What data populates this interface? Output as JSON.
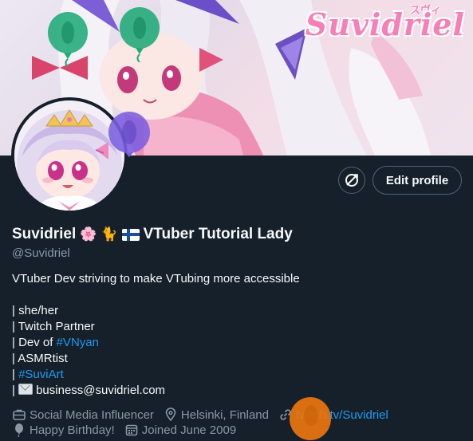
{
  "banner": {
    "logo_text": "Suvidriel",
    "logo_kana": "スヴィ"
  },
  "actions": {
    "icon_button": "nostr-icon",
    "edit_label": "Edit profile"
  },
  "profile": {
    "display_name": "Suvidriel",
    "name_emojis": [
      "🌸",
      "🐈"
    ],
    "name_suffix": "VTuber Tutorial Lady",
    "handle": "@Suvidriel",
    "bio": {
      "intro": "VTuber Dev striving to make VTubing more accessible",
      "pronouns": "| she/her",
      "partner": "| Twitch Partner",
      "dev_prefix": "| Dev of ",
      "dev_link": "#VNyan",
      "asmr": "| ASMRtist",
      "art_prefix": "| ",
      "art_link": "#SuviArt",
      "email_prefix": "| ",
      "email": "business@suvidriel.com"
    },
    "meta": {
      "category": "Social Media Influencer",
      "location": "Helsinki, Finland",
      "website": "twitch.tv/Suvidriel",
      "birthday": "Happy Birthday!",
      "joined": "Joined June 2009"
    }
  },
  "colors": {
    "background": "#15202b",
    "text": "#f7f9f9",
    "secondary": "#8b98a5",
    "link": "#1d9bf0",
    "balloon_green": "#1faa77",
    "balloon_purple": "#7b5fe0",
    "balloon_orange": "#f0780f"
  }
}
